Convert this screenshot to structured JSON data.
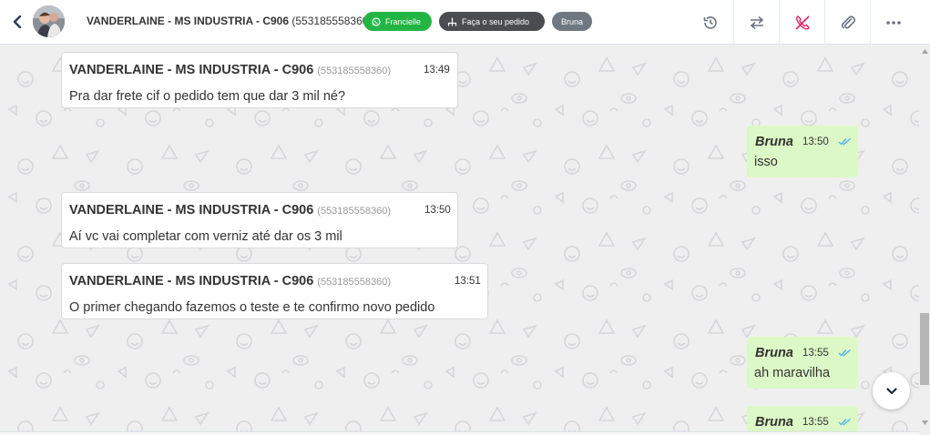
{
  "header": {
    "contact_name": "VANDERLAINE - MS INDUSTRIA - C906",
    "contact_phone": "(553185558360)",
    "chips": {
      "whatsapp": "Francielle",
      "flow": "Faça o seu pedido",
      "agent": "Bruna"
    },
    "icons": [
      "back-chevron-icon",
      "history-icon",
      "transfer-icon",
      "end-call-icon",
      "attachment-icon",
      "more-icon"
    ]
  },
  "colors": {
    "whatsapp_green": "#22b544",
    "outgoing_bubble": "#dcf8c6",
    "read_check": "#4fb3e8"
  },
  "messages": [
    {
      "direction": "in",
      "sender": "VANDERLAINE - MS INDUSTRIA - C906",
      "phone": "(553185558360)",
      "time": "13:49",
      "text": "Pra dar frete cif o pedido tem que dar 3 mil né?"
    },
    {
      "direction": "out",
      "sender": "Bruna",
      "time": "13:50",
      "text": "isso"
    },
    {
      "direction": "in",
      "sender": "VANDERLAINE - MS INDUSTRIA - C906",
      "phone": "(553185558360)",
      "time": "13:50",
      "text": "Aí vc vai completar com verniz até dar os 3 mil"
    },
    {
      "direction": "in",
      "sender": "VANDERLAINE - MS INDUSTRIA - C906",
      "phone": "(553185558360)",
      "time": "13:51",
      "text": "O primer chegando fazemos o teste e te confirmo novo pedido"
    },
    {
      "direction": "out",
      "sender": "Bruna",
      "time": "13:55",
      "text": "ah maravilha"
    },
    {
      "direction": "out",
      "sender": "Bruna",
      "time": "13:55",
      "text": ""
    }
  ]
}
